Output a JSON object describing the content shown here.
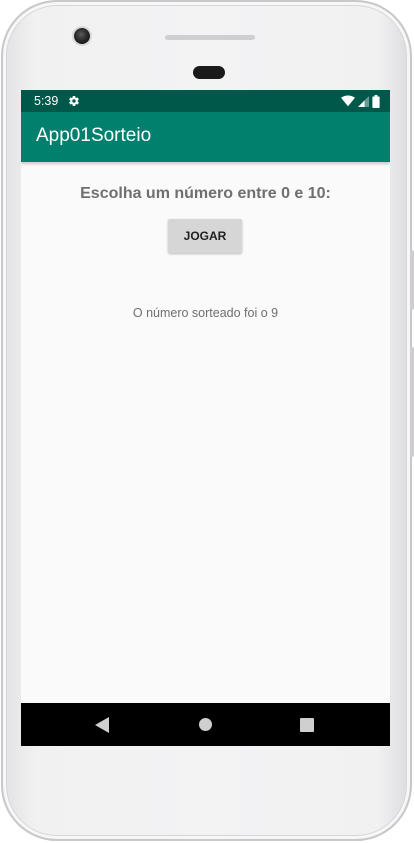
{
  "status_bar": {
    "time": "5:39",
    "icons": [
      "gear-icon",
      "wifi-icon",
      "signal-icon",
      "battery-icon"
    ],
    "background_color": "#00584a"
  },
  "app_bar": {
    "title": "App01Sorteio",
    "background_color": "#00806d"
  },
  "main": {
    "prompt": "Escolha um número entre 0 e 10:",
    "play_button_label": "JOGAR",
    "result_text": "O número sorteado foi o 9"
  },
  "nav_bar": {
    "icons": [
      "back-icon",
      "home-icon",
      "recents-icon"
    ]
  }
}
